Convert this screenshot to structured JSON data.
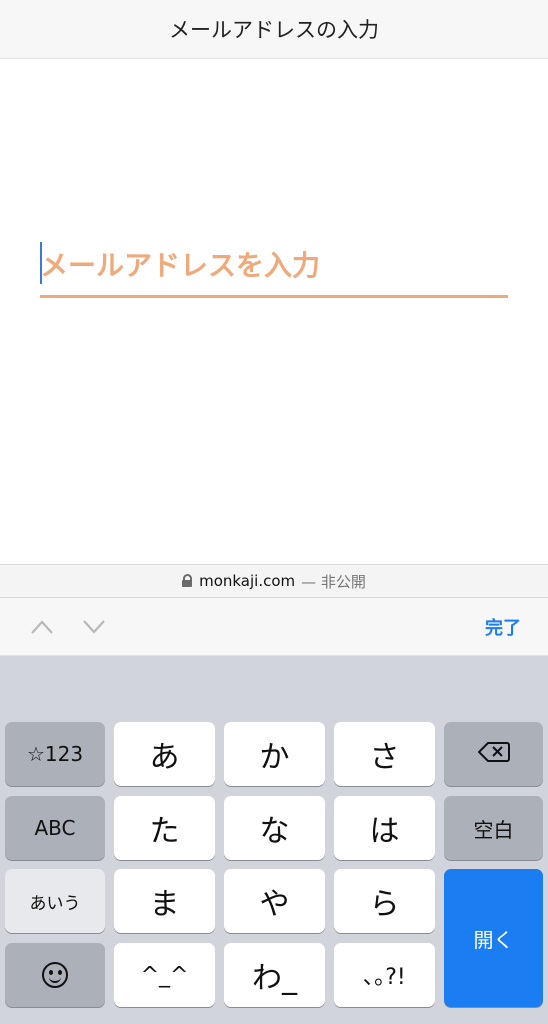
{
  "header": {
    "title": "メールアドレスの入力"
  },
  "form": {
    "email_placeholder": "メールアドレスを入力",
    "email_value": ""
  },
  "urlbar": {
    "domain": "monkaji.com",
    "privacy": "— 非公開"
  },
  "toolbar": {
    "prev_icon": "chevron-up-icon",
    "next_icon": "chevron-down-icon",
    "done_label": "完了"
  },
  "keyboard": {
    "num_mode": "☆123",
    "abc_mode": "ABC",
    "kana_mode": "あいう",
    "emoji_icon": "emoji-icon",
    "delete_icon": "delete-icon",
    "space": "空白",
    "open": "開く",
    "keys": [
      "あ",
      "か",
      "さ",
      "た",
      "な",
      "は",
      "ま",
      "や",
      "ら",
      "^_^",
      "わ_",
      "､｡?!"
    ]
  },
  "colors": {
    "accent": "#f0a97a",
    "link": "#1a7ef2",
    "caret": "#3b78d8",
    "keyboard_bg": "#d1d4db"
  }
}
